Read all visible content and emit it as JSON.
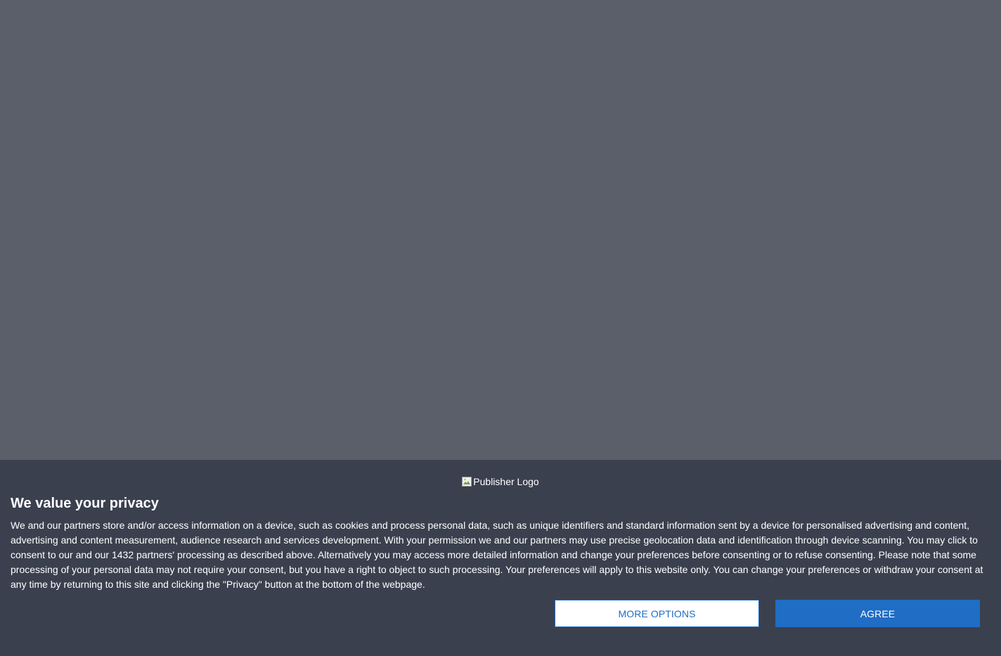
{
  "consent": {
    "logo_alt": "Publisher Logo",
    "title": "We value your privacy",
    "body": "We and our partners store and/or access information on a device, such as cookies and process personal data, such as unique identifiers and standard information sent by a device for personalised advertising and content, advertising and content measurement, audience research and services development. With your permission we and our partners may use precise geolocation data and identification through device scanning. You may click to consent to our and our 1432 partners' processing as described above. Alternatively you may access more detailed information and change your preferences before consenting or to refuse consenting. Please note that some processing of your personal data may not require your consent, but you have a right to object to such processing. Your preferences will apply to this website only. You can change your preferences or withdraw your consent at any time by returning to this site and clicking the \"Privacy\" button at the bottom of the webpage.",
    "more_options_label": "MORE OPTIONS",
    "agree_label": "AGREE"
  },
  "colors": {
    "backdrop": "#5b5f69",
    "panel": "#3a404e",
    "accent": "#206dc5",
    "text": "#ffffff"
  },
  "icons": {
    "logo": "broken-image-icon"
  }
}
